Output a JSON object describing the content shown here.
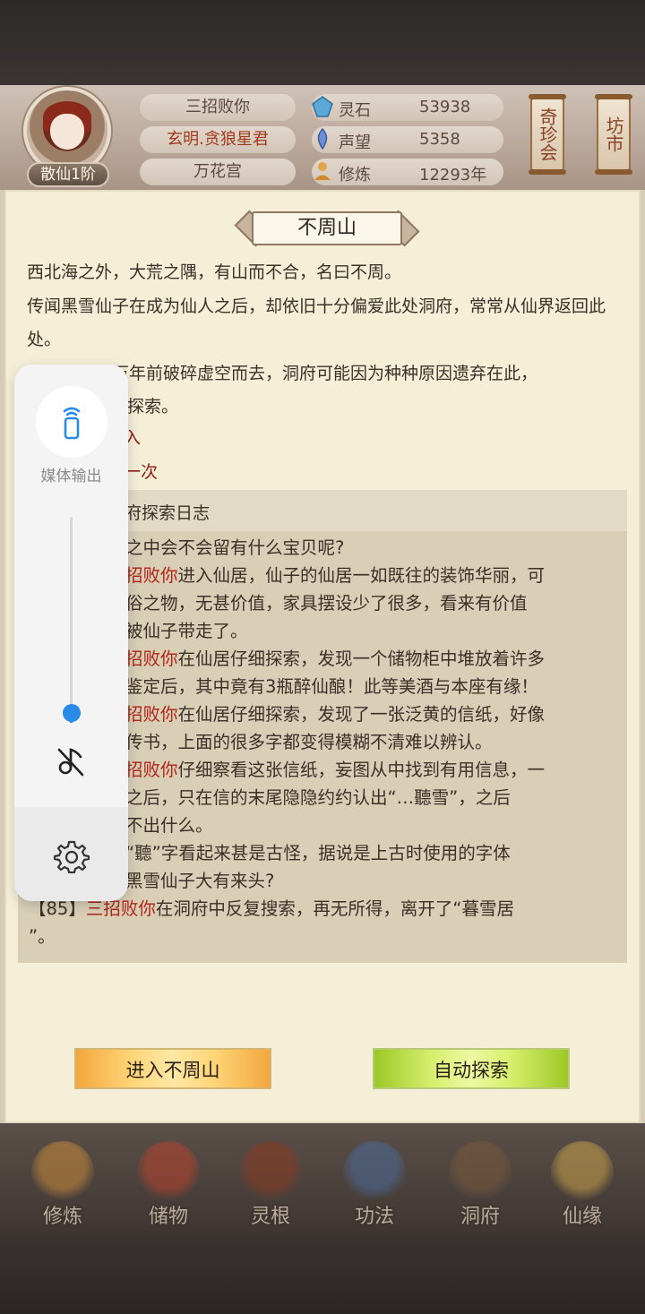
{
  "header": {
    "rank": "散仙1阶",
    "name": "三招败你",
    "title": "玄明.贪狼星君",
    "sect": "万花宫",
    "stats": [
      {
        "icon": "spirit-stone-icon",
        "label": "灵石",
        "value": "53938"
      },
      {
        "icon": "reputation-icon",
        "label": "声望",
        "value": "5358"
      },
      {
        "icon": "cultivation-icon",
        "label": "修炼",
        "value": "12293年"
      }
    ],
    "buttons": {
      "treasure": "奇珍会",
      "market": "坊市"
    }
  },
  "location": {
    "title": "不周山",
    "desc_1": "西北海之外，大荒之隅，有山而不合，名曰不周。",
    "desc_2": "传闻黑雪仙子在成为仙人之后，却依旧十分偏爱此处洞府，常常从仙界返回此处。",
    "desc_3a": "黑雪仙子数万年前破碎虚空而去，洞府可能因为种种原因遗弃在此，",
    "desc_3b": "探索。",
    "enter_hint": "入",
    "count_hint": "一次"
  },
  "log": {
    "title": "洞府探索日志",
    "entries": [
      {
        "prefix": "",
        "name": "",
        "text": "之中会不会留有什么宝贝呢?"
      },
      {
        "prefix": "",
        "name": "招败你",
        "text": "进入仙居，仙子的仙居一如既往的装饰华丽，可"
      },
      {
        "prefix": "",
        "name": "",
        "text": "俗之物，无甚价值，家具摆设少了很多，看来有价值"
      },
      {
        "prefix": "",
        "name": "",
        "text": "被仙子带走了。"
      },
      {
        "prefix": "",
        "name": "招败你",
        "text": "在仙居仔细探索，发现一个储物柜中堆放着许多"
      },
      {
        "prefix": "",
        "name": "",
        "text": "鉴定后，其中竟有3瓶醉仙酿！此等美酒与本座有缘！"
      },
      {
        "prefix": "",
        "name": "招败你",
        "text": "在仙居仔细探索，发现了一张泛黄的信纸，好像"
      },
      {
        "prefix": "",
        "name": "",
        "text": "传书，上面的很多字都变得模糊不清难以辨认。"
      },
      {
        "prefix": "",
        "name": "招败你",
        "text": "仔细察看这张信纸，妄图从中找到有用信息，一"
      },
      {
        "prefix": "",
        "name": "",
        "text": "之后，只在信的末尾隐隐约约认出“…聽雪”，之后"
      },
      {
        "prefix": "",
        "name": "",
        "text": "不出什么。"
      },
      {
        "prefix": "",
        "name": "",
        "text": "“聽”字看起来甚是古怪，据说是上古时使用的字体"
      },
      {
        "prefix": "",
        "name": "",
        "text": "黑雪仙子大有来头?"
      },
      {
        "prefix": "【85】",
        "name": "三招败你",
        "text": "在洞府中反复搜索，再无所得，离开了“暮雪居"
      },
      {
        "prefix": "",
        "name": "",
        "text": "”。"
      }
    ]
  },
  "actions": {
    "enter": "进入不周山",
    "auto": "自动探索"
  },
  "nav": [
    {
      "label": "修炼",
      "icon": "cultivate-icon",
      "color": "#c98a3a"
    },
    {
      "label": "储物",
      "icon": "storage-bag-icon",
      "color": "#b8432c"
    },
    {
      "label": "灵根",
      "icon": "spirit-root-icon",
      "color": "#8a3a20"
    },
    {
      "label": "功法",
      "icon": "technique-book-icon",
      "color": "#4a6a9a"
    },
    {
      "label": "洞府",
      "icon": "cave-house-icon",
      "color": "#7a5a3a"
    },
    {
      "label": "仙缘",
      "icon": "fate-gourd-icon",
      "color": "#c9a24a"
    }
  ],
  "overlay": {
    "cast_label": "媒体输出",
    "volume_level": 0.05,
    "accent": "#2a8ae8"
  }
}
